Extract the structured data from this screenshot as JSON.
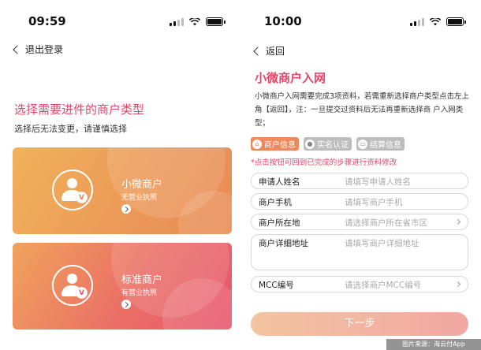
{
  "left_screen": {
    "status_time": "09:59",
    "back_label": "退出登录",
    "title": "选择需要进件的商户类型",
    "subtitle": "选择后无法变更，请谨慎选择",
    "cards": [
      {
        "name": "小微商户",
        "desc": "无营业执照"
      },
      {
        "name": "标准商户",
        "desc": "有营业执照"
      }
    ]
  },
  "right_screen": {
    "status_time": "10:00",
    "back_label": "返回",
    "title": "小微商户入网",
    "description": "小微商户入网需要完成3项资料，若需重新选择商户类型点击左上角【返回】，注：一旦提交过资料后无法再重新选择商 户入网类型；",
    "steps": [
      {
        "label": "商户信息",
        "icon": "home-icon",
        "state": "active"
      },
      {
        "label": "实名认证",
        "icon": "id-icon",
        "state": "inactive"
      },
      {
        "label": "结算信息",
        "icon": "card-icon",
        "state": "inactive"
      }
    ],
    "hint": "*点击按钮可回到已完成的步骤进行资料修改",
    "fields": [
      {
        "label": "申请人姓名",
        "placeholder": "请填写申请人姓名"
      },
      {
        "label": "商户手机",
        "placeholder": "请填写商户手机"
      },
      {
        "label": "商户所在地",
        "placeholder": "请选择商户所在省市区"
      },
      {
        "label": "商户详细地址",
        "placeholder": "请填写商户详细地址"
      },
      {
        "label": "MCC编号",
        "placeholder": "请选择商户MCC编号"
      }
    ],
    "next_label": "下一步"
  },
  "credit": "图片来源：海云付App",
  "colors": {
    "accent": "#e0476a",
    "orange": "#ec8a5d"
  }
}
